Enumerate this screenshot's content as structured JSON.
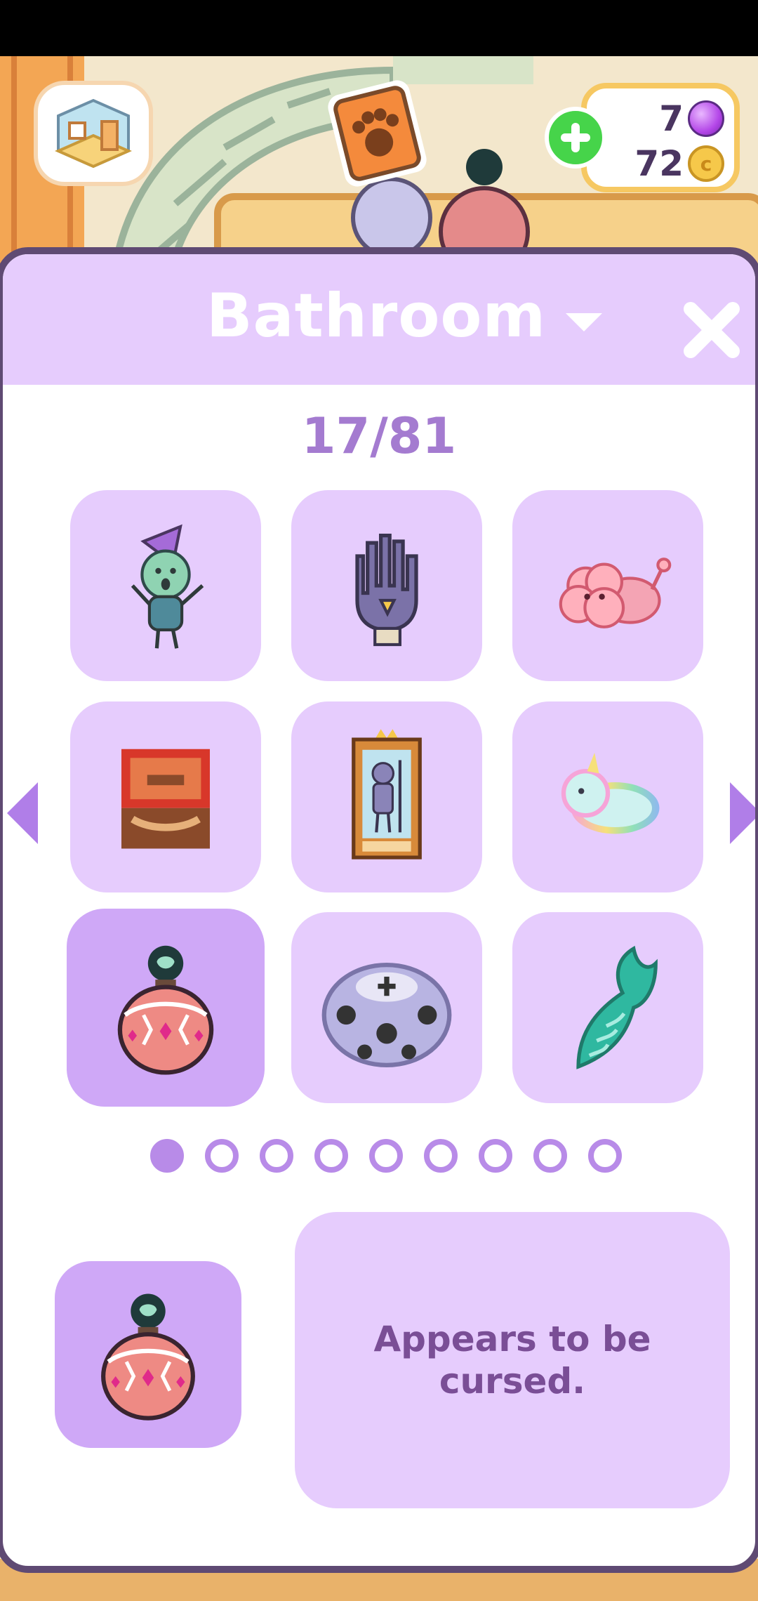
{
  "app": {
    "name": "Room decoration"
  },
  "hud": {
    "gems": "7",
    "coins": "72",
    "coin_symbol": "c",
    "gem_color": "#b447e8",
    "coin_color": "#f6c84a",
    "add_color": "#46d44a"
  },
  "panel": {
    "title": "Bathroom",
    "count": "17/81",
    "accent": "#e6ccfd",
    "selected_color": "#cfa8f7"
  },
  "items": [
    {
      "icon": "gnome-figurine-icon"
    },
    {
      "icon": "purple-glove-icon"
    },
    {
      "icon": "pink-cloud-creature-icon"
    },
    {
      "icon": "red-treasure-chest-icon"
    },
    {
      "icon": "framed-portrait-icon"
    },
    {
      "icon": "rainbow-unicorn-plush-icon"
    },
    {
      "icon": "cursed-perfume-bottle-icon",
      "selected": true
    },
    {
      "icon": "bowling-ball-icon"
    },
    {
      "icon": "mermaid-tail-icon"
    }
  ],
  "pagination": {
    "pages": 9,
    "current": 1
  },
  "selected_item": {
    "icon": "cursed-perfume-bottle-icon",
    "description": "Appears to be cursed."
  }
}
